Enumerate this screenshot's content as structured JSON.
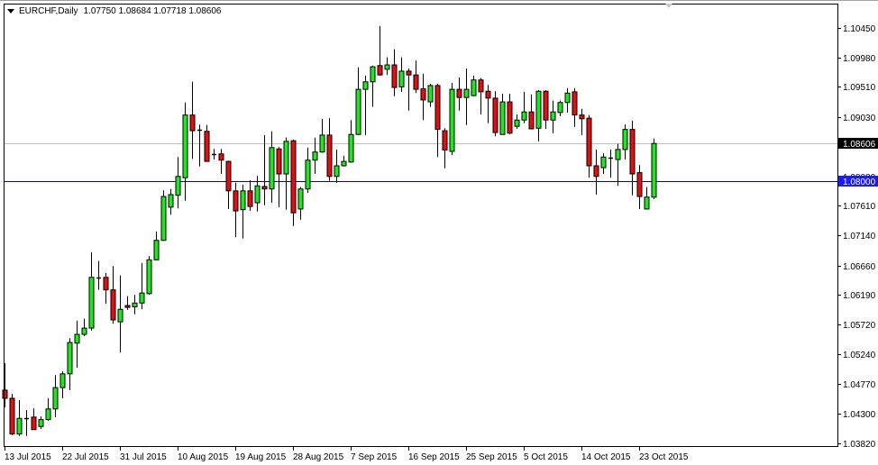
{
  "header": {
    "symbol": "EURCHF,Daily",
    "ohlc": "1.07750 1.08684 1.07718 1.08606"
  },
  "colors": {
    "bull": "#22e622",
    "bear": "#dd1111",
    "price_line": "#c0c0c0",
    "level_line": "#0000cc",
    "badge_bg": "#000000",
    "level_badge_bg": "#1a1aff"
  },
  "chart_data": {
    "type": "candlestick",
    "title": "EURCHF,Daily",
    "ylim": [
      1.03763,
      1.10838
    ],
    "y_ticks": [
      "1.10450",
      "1.09980",
      "1.09510",
      "1.09030",
      "1.08080",
      "1.07610",
      "1.07140",
      "1.06660",
      "1.06190",
      "1.05720",
      "1.05240",
      "1.04770",
      "1.04300",
      "1.03820"
    ],
    "x_labels": [
      {
        "index": 0,
        "label": "13 Jul 2015"
      },
      {
        "index": 8,
        "label": "22 Jul 2015"
      },
      {
        "index": 16,
        "label": "31 Jul 2015"
      },
      {
        "index": 24,
        "label": "10 Aug 2015"
      },
      {
        "index": 32,
        "label": "19 Aug 2015"
      },
      {
        "index": 40,
        "label": "28 Aug 2015"
      },
      {
        "index": 48,
        "label": "7 Sep 2015"
      },
      {
        "index": 56,
        "label": "16 Sep 2015"
      },
      {
        "index": 64,
        "label": "25 Sep 2015"
      },
      {
        "index": 72,
        "label": "5 Oct 2015"
      },
      {
        "index": 80,
        "label": "14 Oct 2015"
      },
      {
        "index": 88,
        "label": "23 Oct 2015"
      }
    ],
    "current_price": {
      "value": 1.08606,
      "label": "1.08606"
    },
    "horizontal_level": {
      "value": 1.08,
      "label": "1.08000"
    },
    "candles_ohlc": [
      [
        1.0467,
        1.051,
        1.044,
        1.0454
      ],
      [
        1.0454,
        1.0461,
        1.0395,
        1.0397
      ],
      [
        1.0397,
        1.0451,
        1.0394,
        1.0422
      ],
      [
        1.0422,
        1.0435,
        1.0394,
        1.0423
      ],
      [
        1.0424,
        1.0438,
        1.0404,
        1.0404
      ],
      [
        1.0409,
        1.0425,
        1.0405,
        1.042
      ],
      [
        1.042,
        1.0454,
        1.0418,
        1.0437
      ],
      [
        1.0437,
        1.0491,
        1.0424,
        1.0471
      ],
      [
        1.0471,
        1.0497,
        1.0454,
        1.0493
      ],
      [
        1.0493,
        1.055,
        1.0467,
        1.0543
      ],
      [
        1.0542,
        1.0578,
        1.0503,
        1.0556
      ],
      [
        1.0556,
        1.0581,
        1.0553,
        1.0566
      ],
      [
        1.0566,
        1.0687,
        1.0562,
        1.0647
      ],
      [
        1.0647,
        1.0673,
        1.0627,
        1.0646
      ],
      [
        1.0647,
        1.0654,
        1.0605,
        1.0627
      ],
      [
        1.0627,
        1.0665,
        1.0573,
        1.0579
      ],
      [
        1.0576,
        1.065,
        1.0527,
        1.0596
      ],
      [
        1.0602,
        1.0617,
        1.0595,
        1.0599
      ],
      [
        1.06,
        1.0619,
        1.0588,
        1.0606
      ],
      [
        1.0606,
        1.067,
        1.0596,
        1.0622
      ],
      [
        1.0621,
        1.0681,
        1.0619,
        1.0675
      ],
      [
        1.0675,
        1.072,
        1.0674,
        1.0706
      ],
      [
        1.0706,
        1.0786,
        1.0705,
        1.0776
      ],
      [
        1.0759,
        1.0788,
        1.0747,
        1.0779
      ],
      [
        1.0778,
        1.0839,
        1.0757,
        1.0808
      ],
      [
        1.0806,
        1.0926,
        1.0769,
        1.0906
      ],
      [
        1.0906,
        1.0959,
        1.0836,
        1.0881
      ],
      [
        1.0881,
        1.0891,
        1.0824,
        1.0882
      ],
      [
        1.088,
        1.089,
        1.0832,
        1.0832
      ],
      [
        1.0844,
        1.0852,
        1.0835,
        1.0843
      ],
      [
        1.0844,
        1.0852,
        1.0812,
        1.0834
      ],
      [
        1.0832,
        1.0833,
        1.0756,
        1.0785
      ],
      [
        1.0785,
        1.0798,
        1.0711,
        1.0753
      ],
      [
        1.0755,
        1.0795,
        1.0709,
        1.0785
      ],
      [
        1.0785,
        1.0802,
        1.0753,
        1.076
      ],
      [
        1.0766,
        1.0809,
        1.0752,
        1.0793
      ],
      [
        1.0792,
        1.0874,
        1.0762,
        1.0788
      ],
      [
        1.0788,
        1.088,
        1.0766,
        1.0854
      ],
      [
        1.0852,
        1.0855,
        1.0759,
        1.0812
      ],
      [
        1.0812,
        1.087,
        1.0755,
        1.0864
      ],
      [
        1.0865,
        1.0867,
        1.0729,
        1.075
      ],
      [
        1.0756,
        1.0791,
        1.0739,
        1.0788
      ],
      [
        1.0788,
        1.0854,
        1.0782,
        1.0834
      ],
      [
        1.0834,
        1.087,
        1.0812,
        1.0847
      ],
      [
        1.0847,
        1.09,
        1.0846,
        1.0874
      ],
      [
        1.0874,
        1.0901,
        1.0801,
        1.0808
      ],
      [
        1.0808,
        1.0851,
        1.0798,
        1.0825
      ],
      [
        1.0825,
        1.0841,
        1.0824,
        1.0832
      ],
      [
        1.0831,
        1.0898,
        1.083,
        1.0875
      ],
      [
        1.0875,
        1.0982,
        1.0874,
        1.0947
      ],
      [
        1.0947,
        1.0969,
        1.0874,
        1.0959
      ],
      [
        1.0959,
        1.0985,
        1.0919,
        1.0983
      ],
      [
        1.0985,
        1.1048,
        1.0969,
        1.097
      ],
      [
        1.0979,
        1.0998,
        1.097,
        1.0986
      ],
      [
        1.0986,
        1.1011,
        1.0936,
        1.095
      ],
      [
        1.0951,
        1.0998,
        1.0943,
        1.0976
      ],
      [
        1.0976,
        1.098,
        1.0913,
        1.097
      ],
      [
        1.097,
        1.0993,
        1.0941,
        1.0947
      ],
      [
        1.0948,
        1.0972,
        1.0898,
        1.093
      ],
      [
        1.0927,
        1.0956,
        1.0919,
        1.0953
      ],
      [
        1.0953,
        1.0956,
        1.0839,
        1.0883
      ],
      [
        1.0881,
        1.0885,
        1.0821,
        1.085
      ],
      [
        1.0848,
        1.0957,
        1.0842,
        1.0947
      ],
      [
        1.0947,
        1.0966,
        1.0913,
        1.0934
      ],
      [
        1.0934,
        1.098,
        1.089,
        1.0947
      ],
      [
        1.0937,
        1.0969,
        1.0936,
        1.0962
      ],
      [
        1.0962,
        1.0965,
        1.0907,
        1.0943
      ],
      [
        1.0944,
        1.0954,
        1.0893,
        1.0933
      ],
      [
        1.0933,
        1.0944,
        1.0872,
        1.0878
      ],
      [
        1.0875,
        1.094,
        1.0875,
        1.0927
      ],
      [
        1.0927,
        1.094,
        1.0875,
        1.0877
      ],
      [
        1.0888,
        1.0907,
        1.0884,
        1.0898
      ],
      [
        1.0898,
        1.0943,
        1.0893,
        1.0911
      ],
      [
        1.0911,
        1.0939,
        1.0883,
        1.0884
      ],
      [
        1.0885,
        1.0946,
        1.0864,
        1.0944
      ],
      [
        1.0944,
        1.0946,
        1.0884,
        1.0898
      ],
      [
        1.0898,
        1.0929,
        1.0877,
        1.0911
      ],
      [
        1.091,
        1.0929,
        1.0904,
        1.0926
      ],
      [
        1.0926,
        1.0949,
        1.091,
        1.0941
      ],
      [
        1.0943,
        1.0949,
        1.0887,
        1.0906
      ],
      [
        1.0906,
        1.0916,
        1.0874,
        1.09
      ],
      [
        1.0901,
        1.0906,
        1.0806,
        1.0825
      ],
      [
        1.0825,
        1.0851,
        1.0779,
        1.0808
      ],
      [
        1.0822,
        1.0845,
        1.0812,
        1.0839
      ],
      [
        1.0838,
        1.0851,
        1.0806,
        1.0838
      ],
      [
        1.0835,
        1.086,
        1.0793,
        1.0851
      ],
      [
        1.0851,
        1.0891,
        1.0835,
        1.0883
      ],
      [
        1.0883,
        1.0897,
        1.0778,
        1.0812
      ],
      [
        1.0814,
        1.0826,
        1.0756,
        1.0776
      ],
      [
        1.0756,
        1.0791,
        1.0756,
        1.0775
      ],
      [
        1.0775,
        1.08684,
        1.07718,
        1.08606
      ]
    ]
  }
}
